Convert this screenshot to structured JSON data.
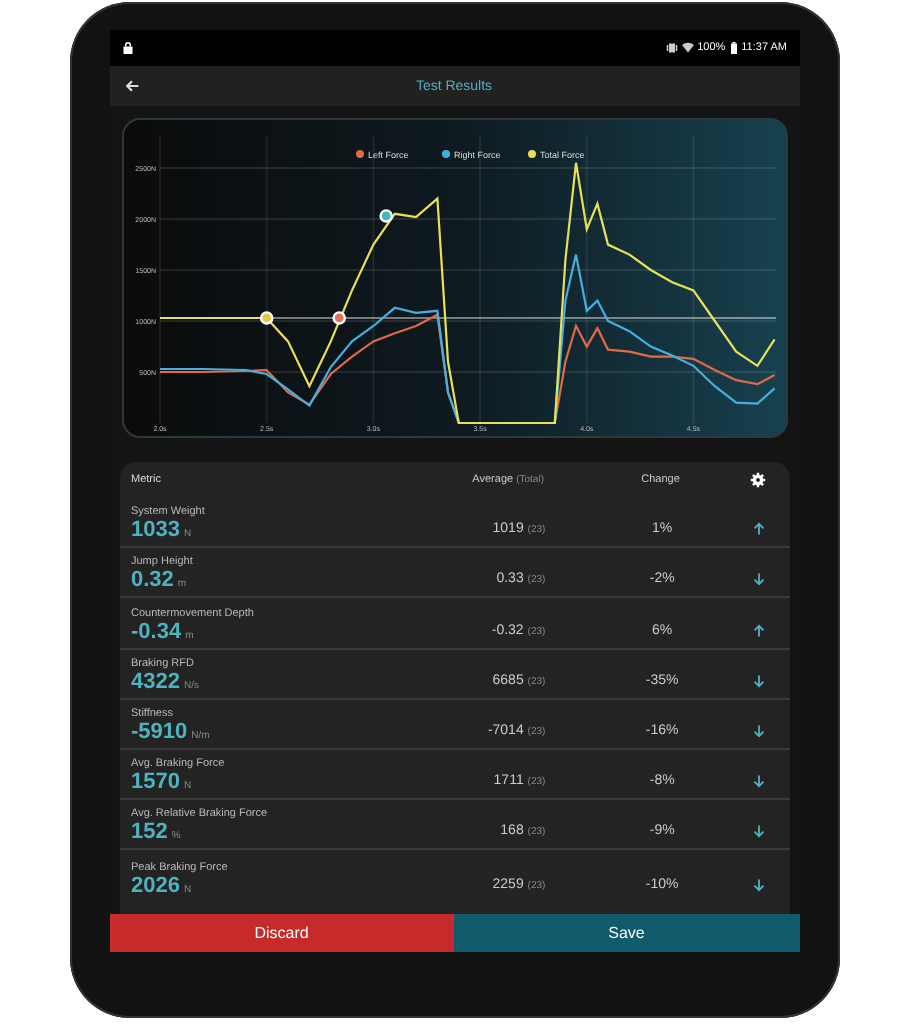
{
  "status_bar": {
    "battery": "100%",
    "time": "11:37 AM"
  },
  "app_bar": {
    "title": "Test Results"
  },
  "chart": {
    "chart_data": {
      "type": "line",
      "x": [
        2.0,
        2.2,
        2.4,
        2.5,
        2.6,
        2.7,
        2.8,
        2.9,
        3.0,
        3.1,
        3.2,
        3.3,
        3.35,
        3.4,
        3.6,
        3.85,
        3.9,
        3.95,
        4.0,
        4.05,
        4.1,
        4.2,
        4.3,
        4.4,
        4.5,
        4.6,
        4.7,
        4.8,
        4.88
      ],
      "series": [
        {
          "name": "Left Force",
          "color": "#e0694a",
          "values": [
            500,
            500,
            510,
            520,
            300,
            180,
            480,
            650,
            800,
            880,
            950,
            1060,
            300,
            0,
            0,
            0,
            600,
            950,
            750,
            930,
            720,
            700,
            650,
            650,
            630,
            520,
            420,
            380,
            470
          ]
        },
        {
          "name": "Right Force",
          "color": "#45b0e0",
          "values": [
            530,
            530,
            520,
            480,
            330,
            170,
            550,
            800,
            950,
            1130,
            1080,
            1100,
            300,
            0,
            0,
            0,
            1200,
            1650,
            1100,
            1200,
            1000,
            900,
            750,
            660,
            560,
            360,
            200,
            190,
            340
          ]
        },
        {
          "name": "Total Force",
          "color": "#e8e05a",
          "values": [
            1030,
            1030,
            1030,
            1030,
            800,
            360,
            800,
            1300,
            1750,
            2050,
            2020,
            2200,
            600,
            0,
            0,
            0,
            1600,
            2550,
            1900,
            2150,
            1750,
            1650,
            1500,
            1380,
            1300,
            1000,
            700,
            560,
            820
          ]
        }
      ],
      "xlim": [
        2.0,
        4.9
      ],
      "ylim": [
        0,
        2800
      ],
      "xticks": [
        {
          "value": 2.0,
          "label": "2.0s"
        },
        {
          "value": 2.5,
          "label": "2.5s"
        },
        {
          "value": 3.0,
          "label": "3.0s"
        },
        {
          "value": 3.5,
          "label": "3.5s"
        },
        {
          "value": 4.0,
          "label": "4.0s"
        },
        {
          "value": 4.5,
          "label": "4.5s"
        }
      ],
      "yticks": [
        {
          "value": 500,
          "label": "500N"
        },
        {
          "value": 1000,
          "label": "1000N"
        },
        {
          "value": 1500,
          "label": "1500N"
        },
        {
          "value": 2000,
          "label": "2000N"
        },
        {
          "value": 2500,
          "label": "2500N"
        }
      ],
      "grid": true,
      "legend": true
    }
  },
  "table": {
    "columns": {
      "metric": "Metric",
      "average": "Average",
      "average_note": "(Total)",
      "change": "Change"
    },
    "rows": [
      {
        "name": "System Weight",
        "value": "1033",
        "unit": "N",
        "average": "1019",
        "count": "(23)",
        "change": "1%",
        "rising": true
      },
      {
        "name": "Jump Height",
        "value": "0.32",
        "unit": "m",
        "average": "0.33",
        "count": "(23)",
        "change": "-2%",
        "rising": false
      },
      {
        "name": "Countermovement Depth",
        "value": "-0.34",
        "unit": "m",
        "average": "-0.32",
        "count": "(23)",
        "change": "6%",
        "rising": true
      },
      {
        "name": "Braking RFD",
        "value": "4322",
        "unit": "N/s",
        "average": "6685",
        "count": "(23)",
        "change": "-35%",
        "rising": false
      },
      {
        "name": "Stiffness",
        "value": "-5910",
        "unit": "N/m",
        "average": "-7014",
        "count": "(23)",
        "change": "-16%",
        "rising": false
      },
      {
        "name": "Avg. Braking Force",
        "value": "1570",
        "unit": "N",
        "average": "1711",
        "count": "(23)",
        "change": "-8%",
        "rising": false
      },
      {
        "name": "Avg. Relative Braking Force",
        "value": "152",
        "unit": "%",
        "average": "168",
        "count": "(23)",
        "change": "-9%",
        "rising": false
      },
      {
        "name": "Peak Braking Force",
        "value": "2026",
        "unit": "N",
        "average": "2259",
        "count": "(23)",
        "change": "-10%",
        "rising": false
      }
    ]
  },
  "buttons": [
    {
      "label": "Discard",
      "kind": "danger"
    },
    {
      "label": "Save",
      "kind": "primary"
    }
  ]
}
